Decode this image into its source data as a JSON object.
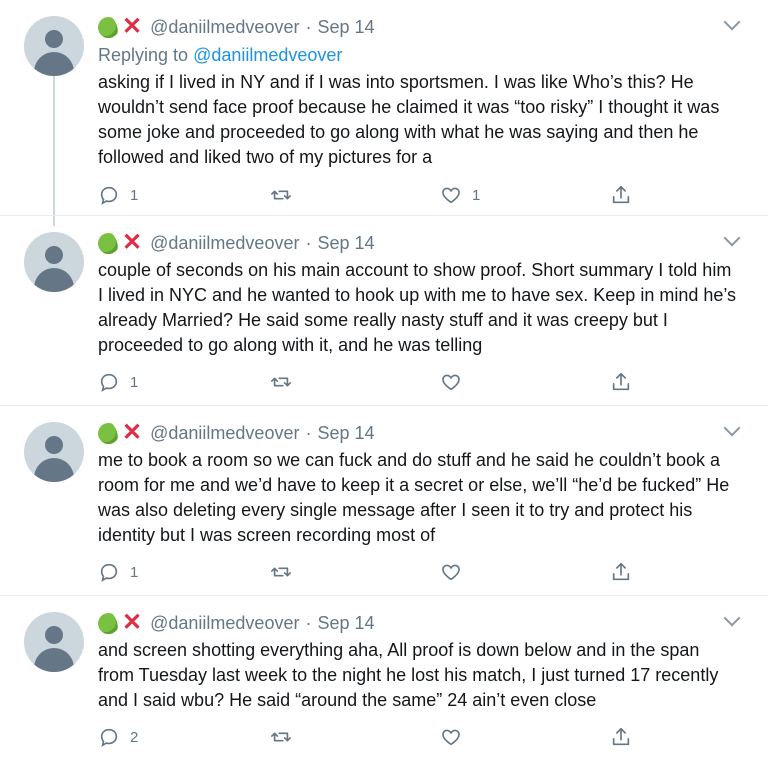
{
  "reply_prefix": "Replying to",
  "tweets": [
    {
      "handle": "@daniilmedveover",
      "separator": "·",
      "date": "Sep 14",
      "reply_to": "@daniilmedveover",
      "text": "asking if I lived in NY and if I was into sportsmen. I was like Who’s this? He wouldn’t send face proof because he claimed it was “too risky” I thought it was some joke and proceeded to go along with what he was saying and then he followed and liked two of my pictures for a",
      "replies": "1",
      "likes": "1"
    },
    {
      "handle": "@daniilmedveover",
      "separator": "·",
      "date": "Sep 14",
      "text": "couple of seconds on his main account to show proof. Short summary I told him I lived in NYC and he wanted to hook up with me to have sex. Keep in mind he’s already Married? He said some really nasty stuff and it was creepy but I proceeded to go along with it, and he was telling",
      "replies": "1",
      "likes": ""
    },
    {
      "handle": "@daniilmedveover",
      "separator": "·",
      "date": "Sep 14",
      "text": "me to book a room so we can fuck and do stuff and he said he couldn’t book a room for me and we’d have to keep it a secret or else, we’ll “he’d be fucked” He was also deleting every single message after I seen it to try and protect his identity but I was screen recording most of",
      "replies": "1",
      "likes": ""
    },
    {
      "handle": "@daniilmedveover",
      "separator": "·",
      "date": "Sep 14",
      "text": "and screen shotting everything aha, All proof is down below and in the span from Tuesday last week to the night he lost his match, I just turned 17 recently and I said wbu? He said “around the same” 24 ain’t even close",
      "replies": "2",
      "likes": ""
    }
  ],
  "icons": {
    "reply": "reply-icon",
    "retweet": "retweet-icon",
    "like": "heart-icon",
    "share": "share-icon",
    "more": "chevron-down-icon",
    "emoji1": "tennis-ball-emoji",
    "emoji2": "red-x-emoji"
  },
  "colors": {
    "text": "#14171a",
    "muted": "#657786",
    "link": "#1b95e0",
    "avatar_bg": "#ccd6dd",
    "thread_line": "#ccd6dd"
  }
}
